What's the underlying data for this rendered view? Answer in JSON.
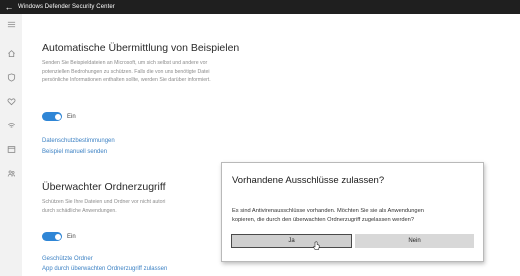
{
  "window": {
    "title": "Windows Defender Security Center"
  },
  "nav": {
    "icons": [
      "back-arrow-icon",
      "home-icon",
      "shield-icon",
      "heart-icon",
      "wifi-icon",
      "browser-icon",
      "family-icon"
    ]
  },
  "sample_submission": {
    "title": "Automatische Übermittlung von Beispielen",
    "desc_lines": [
      "Senden Sie Beispieldateien an Microsoft, um sich selbst und andere vor",
      "potenziellen Bedrohungen zu schützen. Falls die von uns benötigte Datei",
      "persönliche Informationen enthalten sollte, werden Sie darüber informiert."
    ],
    "toggle_label": "Ein",
    "link_privacy": "Datenschutzbestimmungen",
    "link_manual": "Beispiel manuell senden"
  },
  "folder_access": {
    "title": "Überwachter Ordnerzugriff",
    "desc_lines": [
      "Schützen Sie Ihre Dateien und Ordner vor nicht autori",
      "durch schädliche Anwendungen."
    ],
    "toggle_label": "Ein",
    "link_protected": "Geschützte Ordner",
    "link_allow_app": "App durch überwachten Ordnerzugriff zulassen"
  },
  "dialog": {
    "title": "Vorhandene Ausschlüsse zulassen?",
    "body_lines": [
      "Es sind Antivirenausschlüsse vorhanden. Möchten Sie sie als Anwendungen",
      "kopieren, die durch den überwachten Ordnerzugriff zugelassen werden?"
    ],
    "yes_label": "Ja",
    "no_label": "Nein"
  },
  "colors": {
    "accent": "#2f86d6",
    "link": "#3d82c4",
    "titlebar": "#1f1f1f"
  }
}
